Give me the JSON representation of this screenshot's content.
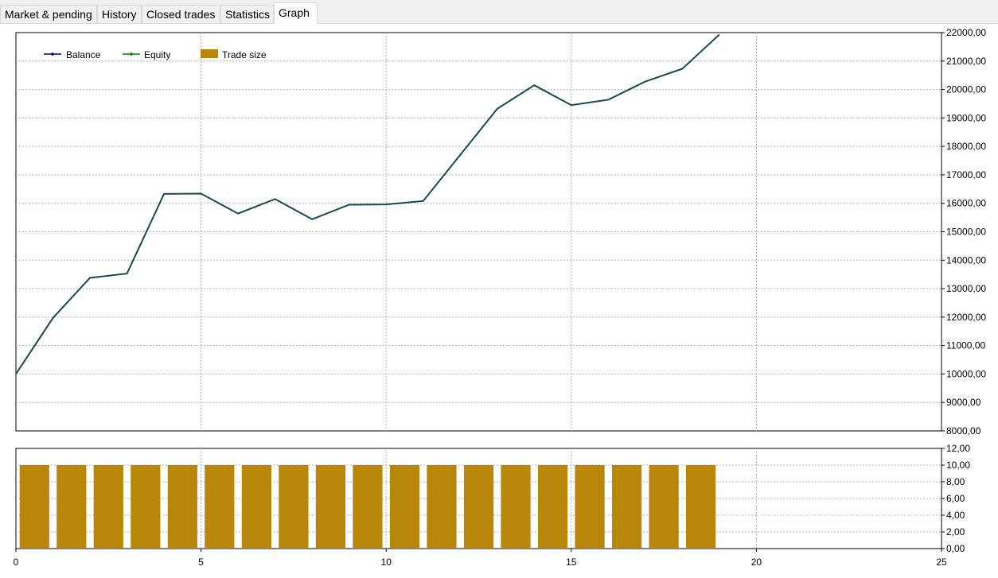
{
  "tabs": [
    {
      "label": "Market & pending",
      "active": false
    },
    {
      "label": "History",
      "active": false
    },
    {
      "label": "Closed trades",
      "active": false
    },
    {
      "label": "Statistics",
      "active": false
    },
    {
      "label": "Graph",
      "active": true
    }
  ],
  "legend": {
    "balance": "Balance",
    "equity": "Equity",
    "trade_size": "Trade size"
  },
  "colors": {
    "balance": "#00008b",
    "equity": "#008000",
    "combined_line": "#1c4a4f",
    "trade_size": "#b8860b",
    "grid": "#b4b4b4"
  },
  "chart_data": [
    {
      "type": "line",
      "x": [
        0,
        1,
        2,
        3,
        4,
        5,
        6,
        7,
        8,
        9,
        10,
        11,
        12,
        13,
        14,
        15,
        16,
        17,
        18,
        19
      ],
      "series": [
        {
          "name": "Balance",
          "values": [
            10000,
            11970,
            13380,
            13530,
            16330,
            16340,
            15640,
            16150,
            15440,
            15950,
            15960,
            16080,
            17700,
            19320,
            20150,
            19450,
            19640,
            20280,
            20730,
            21930
          ]
        },
        {
          "name": "Equity",
          "values": [
            10000,
            11970,
            13380,
            13530,
            16330,
            16340,
            15640,
            16150,
            15440,
            15950,
            15960,
            16080,
            17700,
            19320,
            20150,
            19450,
            19640,
            20280,
            20730,
            21930
          ]
        }
      ],
      "xlim": [
        0,
        25
      ],
      "ylim": [
        8000,
        22000
      ],
      "yticks": [
        "8000,00",
        "9000,00",
        "10000,00",
        "11000,00",
        "12000,00",
        "13000,00",
        "14000,00",
        "15000,00",
        "16000,00",
        "17000,00",
        "18000,00",
        "19000,00",
        "20000,00",
        "21000,00",
        "22000,00"
      ],
      "grid": true,
      "legend": "top-left"
    },
    {
      "type": "bar",
      "x": [
        1,
        2,
        3,
        4,
        5,
        6,
        7,
        8,
        9,
        10,
        11,
        12,
        13,
        14,
        15,
        16,
        17,
        18,
        19
      ],
      "series": [
        {
          "name": "Trade size",
          "values": [
            10,
            10,
            10,
            10,
            10,
            10,
            10,
            10,
            10,
            10,
            10,
            10,
            10,
            10,
            10,
            10,
            10,
            10,
            10
          ]
        }
      ],
      "xlim": [
        0,
        25
      ],
      "ylim": [
        0,
        12
      ],
      "yticks": [
        "0,00",
        "2,00",
        "4,00",
        "6,00",
        "8,00",
        "10,00",
        "12,00"
      ],
      "xticks": [
        "0",
        "5",
        "10",
        "15",
        "20",
        "25"
      ],
      "grid": true
    }
  ]
}
